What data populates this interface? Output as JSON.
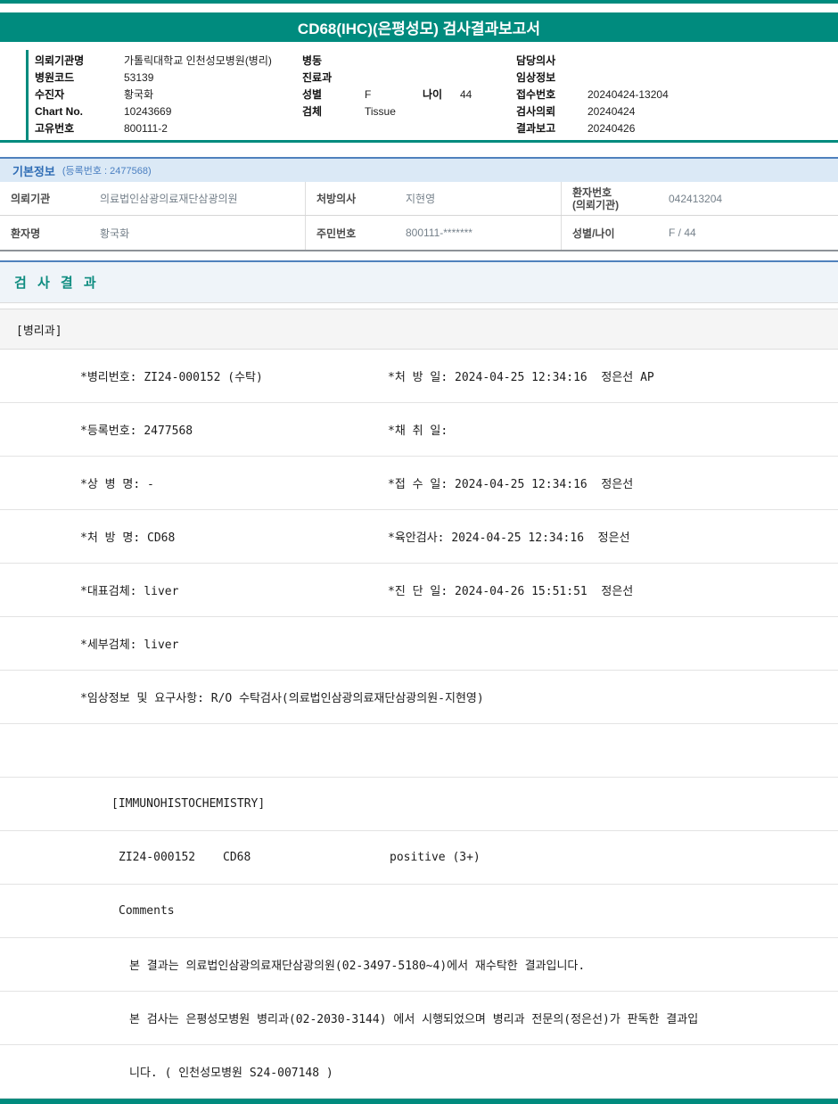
{
  "theme": {
    "teal": "#008b7e",
    "section_border_blue": "#4f81bd",
    "basic_info_bar_bg": "#dbe9f6",
    "results_bar_bg": "#eff4f9",
    "results_title_color": "#0e8c80"
  },
  "header": {
    "title": "CD68(IHC)(은평성모) 검사결과보고서"
  },
  "meta": {
    "col1": [
      {
        "label": "의뢰기관명",
        "value": "가톨릭대학교 인천성모병원(병리)"
      },
      {
        "label": "병원코드",
        "value": "53139"
      },
      {
        "label": "수진자",
        "value": "황국화"
      },
      {
        "label": "Chart No.",
        "value": "10243669"
      },
      {
        "label": "고유번호",
        "value": "800111-2"
      }
    ],
    "col2": [
      {
        "label": "병동",
        "value": ""
      },
      {
        "label": "진료과",
        "value": ""
      },
      {
        "label": "성별",
        "value": "F"
      },
      {
        "label": "검체",
        "value": "Tissue"
      }
    ],
    "age": {
      "label": "나이",
      "value": "44"
    },
    "col3": [
      {
        "label": "담당의사",
        "value": ""
      },
      {
        "label": "임상정보",
        "value": ""
      },
      {
        "label": "접수번호",
        "value": "20240424-13204"
      },
      {
        "label": "검사의뢰",
        "value": "20240424"
      },
      {
        "label": "결과보고",
        "value": "20240426"
      }
    ]
  },
  "basic_info": {
    "title": "기본정보",
    "subtitle": "(등록번호 : 2477568)",
    "row1": {
      "c1_label": "의뢰기관",
      "c1_value": "의료법인삼광의료재단삼광의원",
      "c2_label": "처방의사",
      "c2_value": "지현영",
      "c3_label_line1": "환자번호",
      "c3_label_line2": "(의뢰기관)",
      "c3_value": "042413204"
    },
    "row2": {
      "c1_label": "환자명",
      "c1_value": "황국화",
      "c2_label": "주민번호",
      "c2_value": "800111-*******",
      "c3_label": "성별/나이",
      "c3_value": "F / 44"
    }
  },
  "results": {
    "title": "검 사 결 과",
    "department": "[병리과]",
    "detail_rows": [
      {
        "left": "*병리번호: ZI24-000152 (수탁)",
        "right": "*처 방 일: 2024-04-25 12:34:16  정은선 AP"
      },
      {
        "left": "*등록번호: 2477568",
        "right": "*채 취 일:"
      },
      {
        "left": "*상 병 명: -",
        "right": "*접 수 일: 2024-04-25 12:34:16  정은선"
      },
      {
        "left": "*처 방 명: CD68",
        "right": "*육안검사: 2024-04-25 12:34:16  정은선"
      },
      {
        "left": "*대표검체: liver",
        "right": "*진 단 일: 2024-04-26 15:51:51  정은선"
      },
      {
        "left": "*세부검체: liver",
        "right": ""
      }
    ],
    "clinical_info": "*임상정보 및 요구사항: R/O 수탁검사(의료법인삼광의료재단삼광의원-지현영)",
    "ihc_header": "[IMMUNOHISTOCHEMISTRY]",
    "ihc_result": {
      "specimen_no": "ZI24-000152",
      "test_name": "CD68",
      "result": "positive (3+)"
    },
    "comments_label": "Comments",
    "comment_lines": [
      "본 결과는 의료법인삼광의료재단삼광의원(02-3497-5180~4)에서 재수탁한 결과입니다.",
      "본 검사는 은평성모병원 병리과(02-2030-3144) 에서 시행되었으며 병리과 전문의(정은선)가 판독한 결과입",
      "니다. ( 인천성모병원 S24-007148 )"
    ]
  }
}
